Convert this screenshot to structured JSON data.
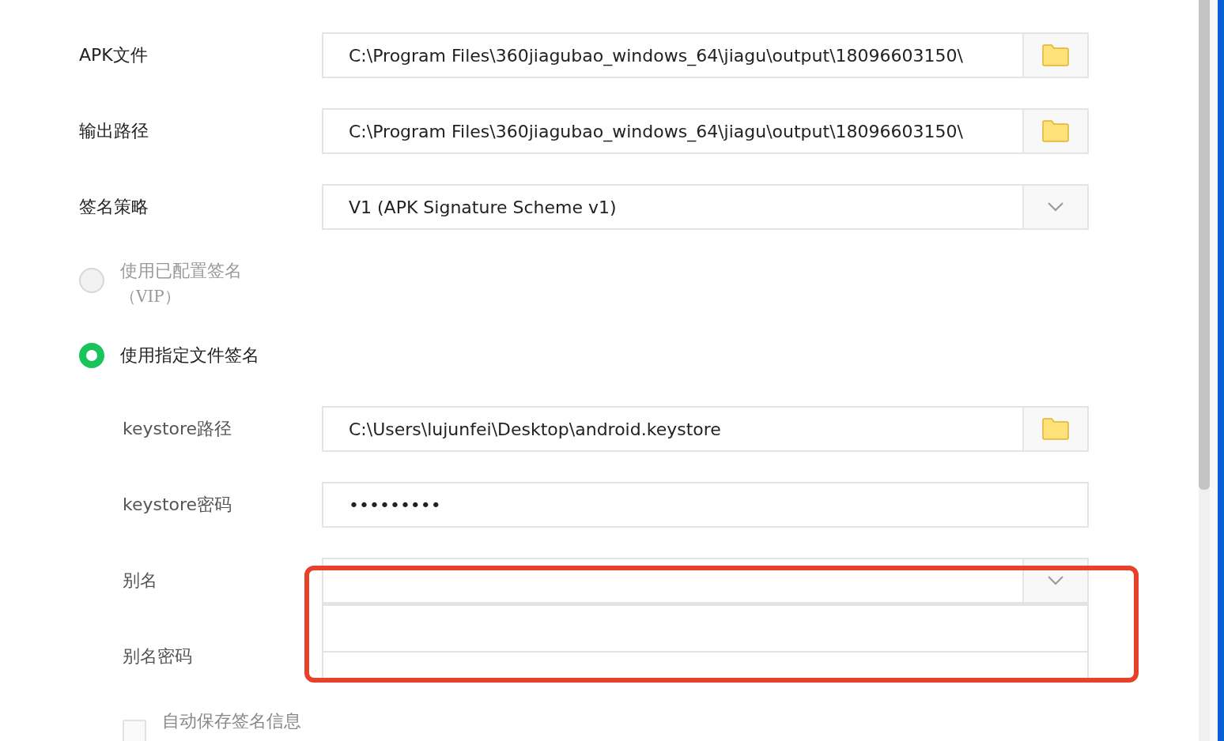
{
  "rows": [
    {
      "kind": "file",
      "label": "APK文件",
      "value": "C:\\Program Files\\360jiagubao_windows_64\\jiagu\\output\\18096603150\\"
    },
    {
      "kind": "file",
      "label": "输出路径",
      "value": "C:\\Program Files\\360jiagubao_windows_64\\jiagu\\output\\18096603150\\"
    },
    {
      "kind": "select",
      "label": "签名策略",
      "value": "V1 (APK Signature Scheme v1)"
    },
    {
      "kind": "radio",
      "label": "使用已配置签名",
      "note": "（VIP）",
      "selected": false,
      "disabled": true
    },
    {
      "kind": "radio",
      "label": "使用指定文件签名",
      "selected": true,
      "disabled": false
    },
    {
      "kind": "file",
      "label": "keystore路径",
      "value": "C:\\Users\\lujunfei\\Desktop\\android.keystore",
      "sub": true
    },
    {
      "kind": "password",
      "label": "keystore密码",
      "value": "•••••••••",
      "sub": true
    },
    {
      "kind": "select",
      "label": "别名",
      "expanded": true,
      "sub": true
    },
    {
      "kind": "password",
      "label": "别名密码",
      "sub": true
    },
    {
      "kind": "checkbox",
      "label": "自动保存签名信息",
      "checked": false,
      "disabled": true
    }
  ],
  "annotation": {
    "kind": "rect"
  }
}
